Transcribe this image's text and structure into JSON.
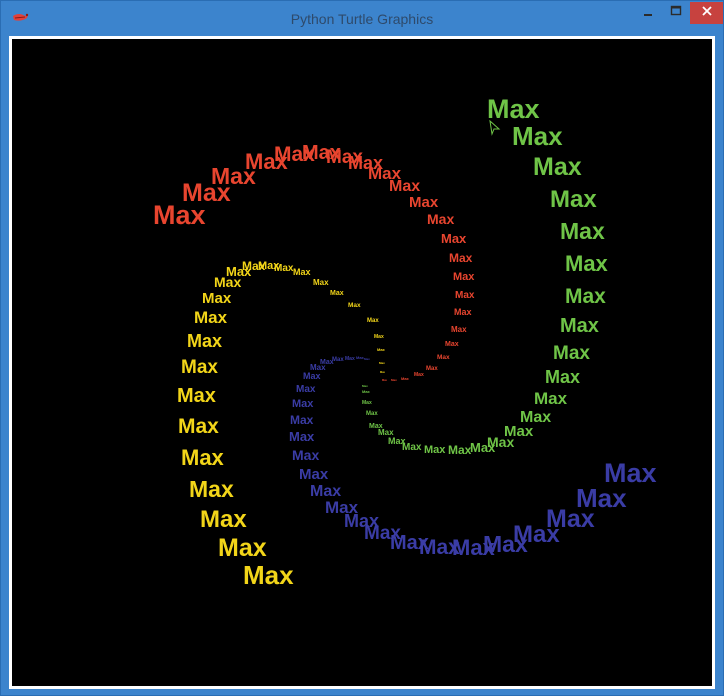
{
  "window": {
    "title": "Python Turtle Graphics",
    "app_icon": "turtle-feather-icon",
    "controls": [
      "minimize-icon",
      "maximize-icon",
      "close-icon"
    ]
  },
  "canvas": {
    "background": "#000000",
    "word": "Max",
    "colors": {
      "red": "#e8452f",
      "yellow": "#f2d519",
      "green": "#6fc447",
      "blue": "#3a3ca5"
    },
    "cursor": "turtle-arrow-icon"
  }
}
